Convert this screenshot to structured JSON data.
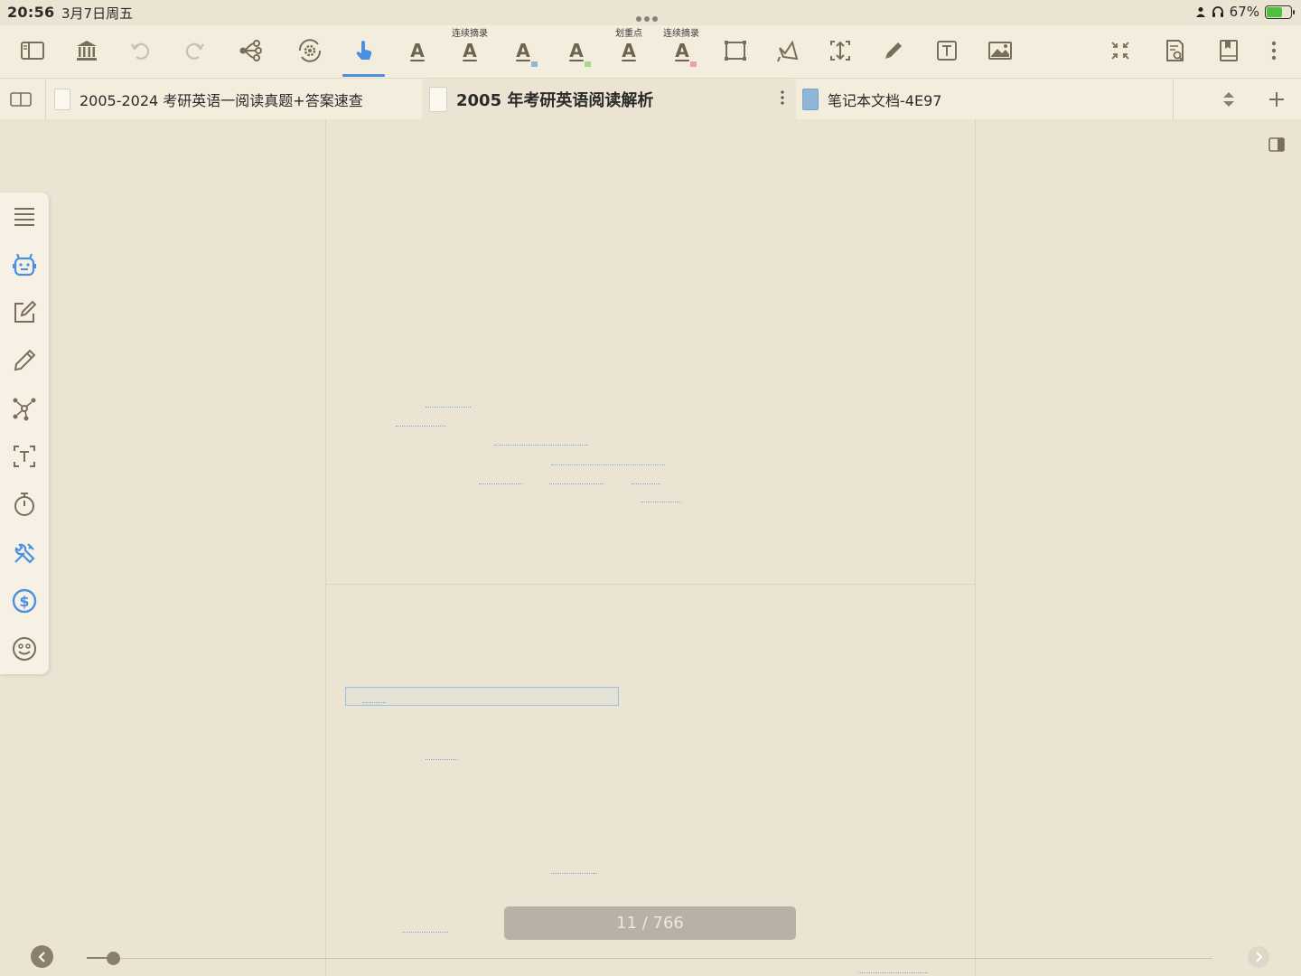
{
  "status": {
    "time": "20:56",
    "date": "3月7日周五",
    "battery": "67%",
    "battery_level": 0.67
  },
  "toolbar": {
    "captions": {
      "continuous_excerpt_1": "连续摘录",
      "highlight": "划重点",
      "continuous_excerpt_2": "连续摘录"
    },
    "icons": [
      "sidebar-toggle-icon",
      "library-icon",
      "undo-icon",
      "redo-icon",
      "mindmap-icon",
      "sync-gear-icon",
      "hand-pointer-icon",
      "text-underline-icon",
      "text-excerpt-icon",
      "text-blue-marker-icon",
      "text-green-marker-icon",
      "text-highlight-icon",
      "text-red-marker-icon",
      "rect-select-icon",
      "lasso-icon",
      "crop-icon",
      "pencil-icon",
      "text-box-icon",
      "image-icon",
      "collapse-icon",
      "search-document-icon",
      "bookmark-icon",
      "more-icon"
    ]
  },
  "tabs": [
    {
      "label": "2005-2024 考研英语一阅读真题+答案速查"
    },
    {
      "label": "2005 年考研英语阅读解析"
    },
    {
      "label": "笔记本文档-4E97"
    }
  ],
  "pager": {
    "current": 11,
    "total": 766,
    "label": "11 / 766"
  },
  "colors": {
    "accent": "#4a90e2",
    "background": "#ebe4d2",
    "toolbar_bg": "#f3eddd",
    "brown": "#8a7e6c"
  }
}
